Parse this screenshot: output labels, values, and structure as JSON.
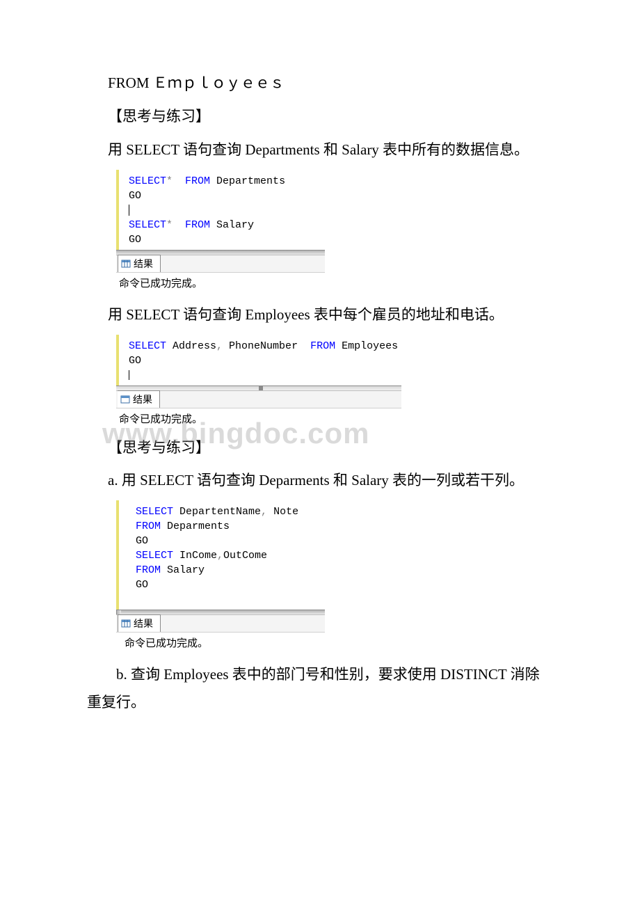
{
  "line1_from": "FROM",
  "line1_table": "Ｅｍｐｌｏｙｅｅｓ",
  "heading_think": "【思考与练习】",
  "para1": "用 SELECT 语句查询 Departments 和 Salary 表中所有的数据信息。",
  "code1": {
    "l1a": "SELECT",
    "l1b": "*",
    "l1c": "  FROM",
    "l1d": " Departments",
    "l2": "GO",
    "l3_cursor": "|",
    "l4a": "SELECT",
    "l4b": "*",
    "l4c": "  FROM",
    "l4d": " Salary",
    "l5": "GO"
  },
  "tab_label": "结果",
  "status_ok": "命令已成功完成。",
  "para2": "用 SELECT 语句查询 Employees 表中每个雇员的地址和电话。",
  "code2": {
    "l1a": "SELECT",
    "l1b": " Address",
    "l1c": ",",
    "l1d": " PhoneNumber  ",
    "l1e": "FROM",
    "l1f": " Employees",
    "l2": "GO"
  },
  "watermark_text": "www.bingdoc.com",
  "heading_think2": "【思考与练习】",
  "para3": "a. 用 SELECT 语句查询 Deparments 和 Salary 表的一列或若干列。",
  "code3": {
    "l1a": "SELECT",
    "l1b": " DepartentName",
    "l1c": ",",
    "l1d": " Note",
    "l2a": "FROM",
    "l2b": " Deparments",
    "l3": "GO",
    "l4a": "SELECT",
    "l4b": " InCome",
    "l4c": ",",
    "l4d": "OutCome",
    "l5a": "FROM",
    "l5b": " Salary",
    "l6": "GO"
  },
  "para4": "b. 查询 Employees 表中的部门号和性别，要求使用 DISTINCT 消除重复行。"
}
